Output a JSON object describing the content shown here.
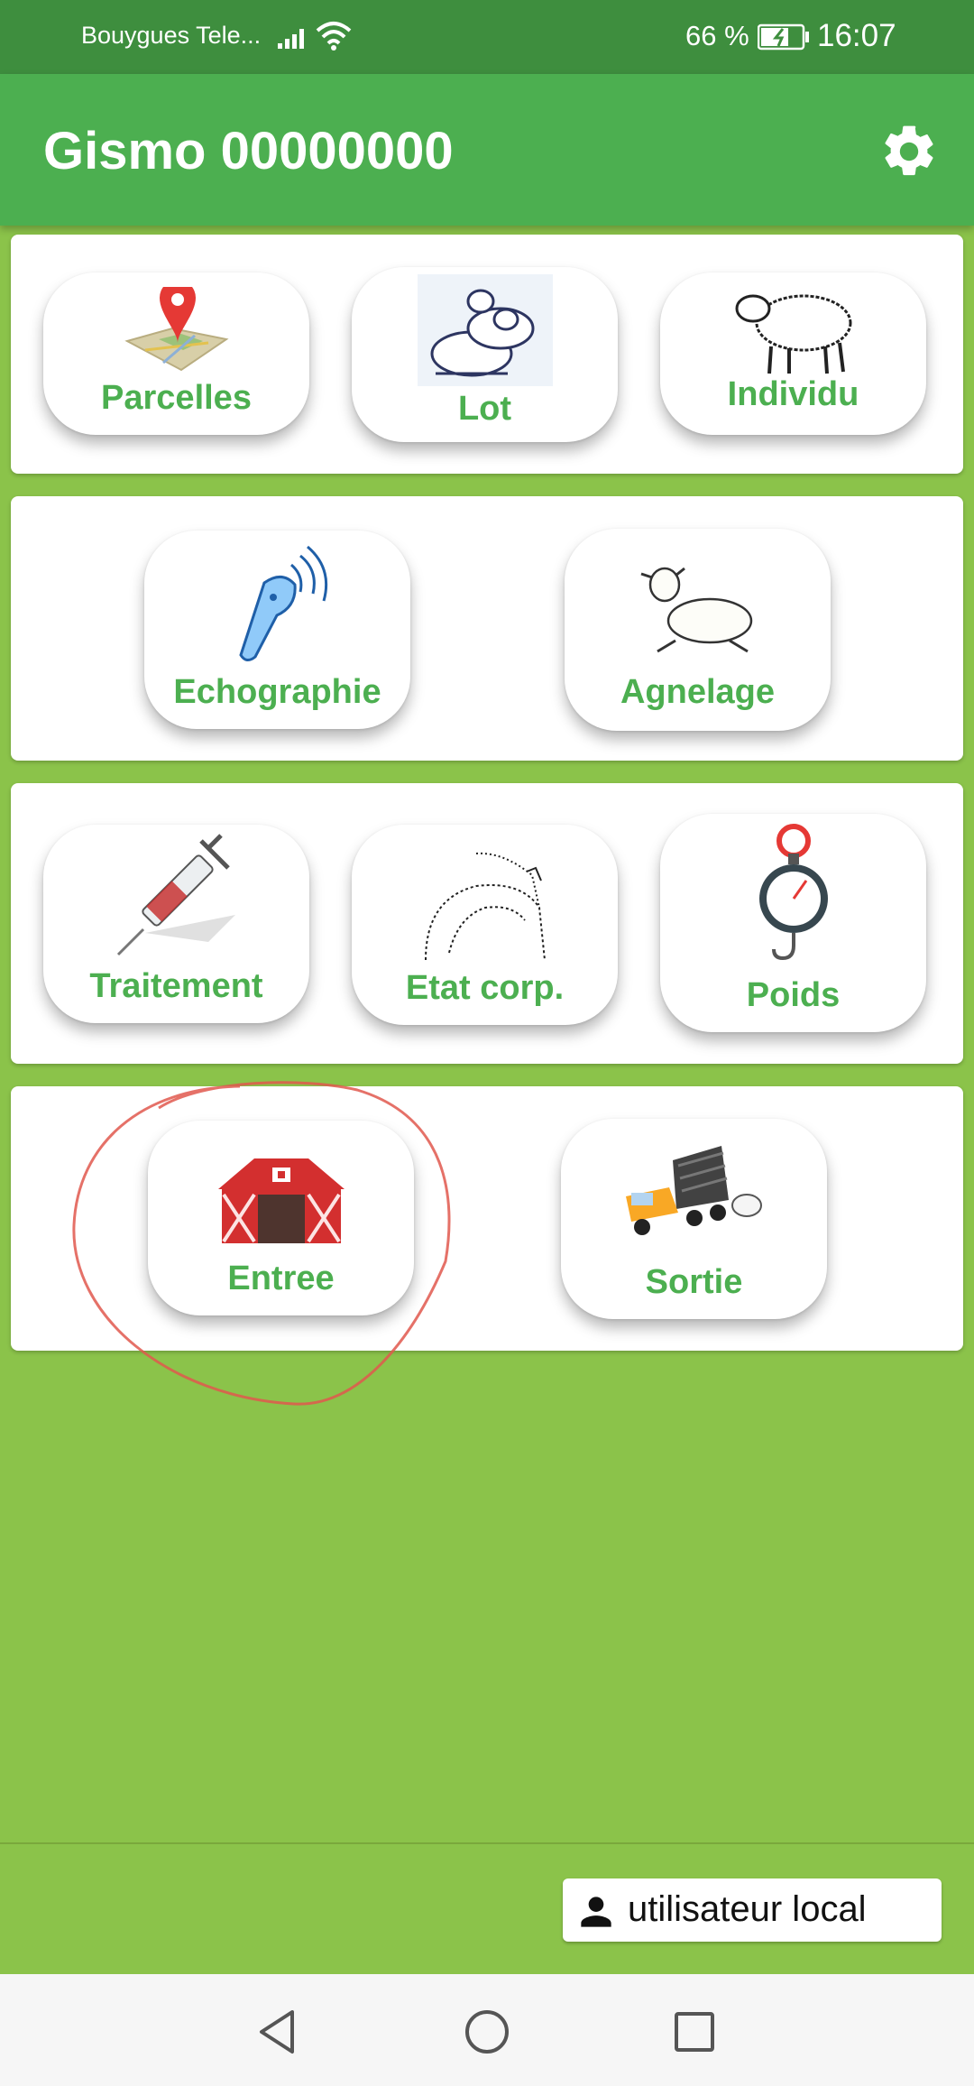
{
  "status_bar": {
    "carrier": "Bouygues Tele...",
    "battery_percent": "66 %",
    "time": "16:07"
  },
  "app_bar": {
    "title": "Gismo 00000000",
    "settings_icon": "gear-icon"
  },
  "groups": [
    {
      "tiles": [
        {
          "label": "Parcelles",
          "icon": "map-pin-icon"
        },
        {
          "label": "Lot",
          "icon": "sheep-group-icon"
        },
        {
          "label": "Individu",
          "icon": "sheep-icon"
        }
      ]
    },
    {
      "tiles": [
        {
          "label": "Echographie",
          "icon": "ultrasound-probe-icon"
        },
        {
          "label": "Agnelage",
          "icon": "lamb-icon"
        }
      ]
    },
    {
      "tiles": [
        {
          "label": "Traitement",
          "icon": "syringe-icon"
        },
        {
          "label": "Etat corp.",
          "icon": "body-condition-icon"
        },
        {
          "label": "Poids",
          "icon": "scale-icon"
        }
      ]
    },
    {
      "tiles": [
        {
          "label": "Entree",
          "icon": "barn-icon"
        },
        {
          "label": "Sortie",
          "icon": "truck-icon"
        }
      ]
    }
  ],
  "footer": {
    "user_label": "utilisateur local",
    "user_icon": "person-icon"
  },
  "colors": {
    "background": "#8bc34a",
    "app_bar": "#4caf50",
    "status_bar": "#3e8e3e",
    "tile_label": "#4caf50",
    "annotation": "#e0584e"
  }
}
